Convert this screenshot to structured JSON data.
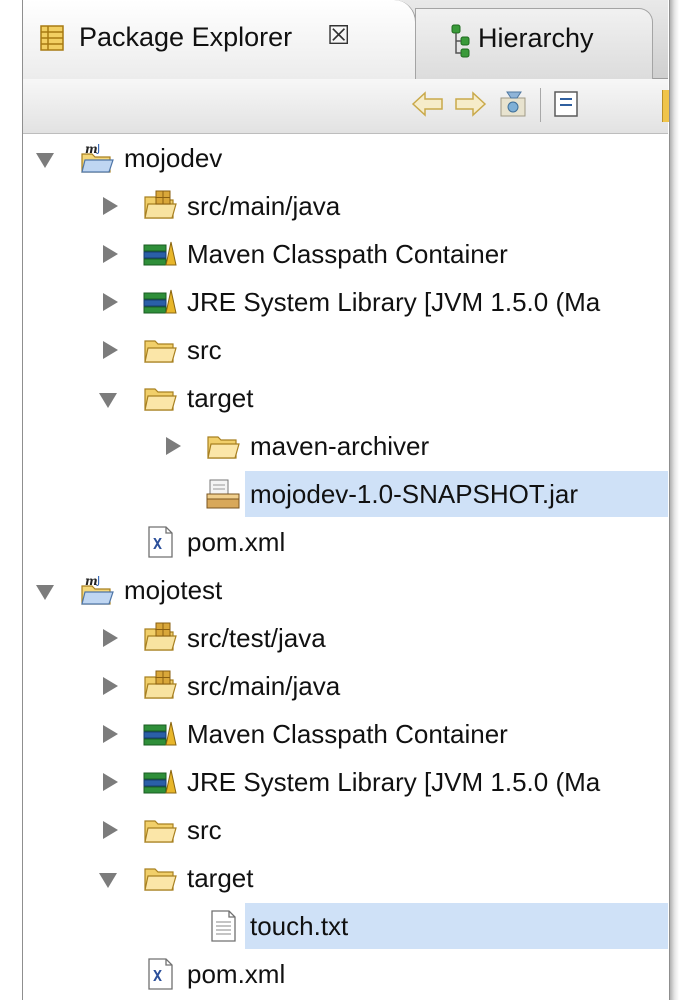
{
  "tabs": {
    "active": {
      "label": "Package Explorer",
      "close": "☒"
    },
    "inactive": {
      "label": "Hierarchy"
    }
  },
  "toolbar": {
    "buttons": [
      "back-icon",
      "forward-icon",
      "go-into-icon",
      "collapse-all-icon"
    ]
  },
  "tree": [
    {
      "label": "mojodev",
      "icon": "maven-project-icon",
      "depth": 0,
      "expander": "open"
    },
    {
      "label": "src/main/java",
      "icon": "source-folder-icon",
      "depth": 1,
      "expander": "closed"
    },
    {
      "label": "Maven Classpath Container",
      "icon": "library-icon",
      "depth": 1,
      "expander": "closed"
    },
    {
      "label": "JRE System Library [JVM 1.5.0 (Ma",
      "icon": "library-icon",
      "depth": 1,
      "expander": "closed"
    },
    {
      "label": "src",
      "icon": "folder-icon",
      "depth": 1,
      "expander": "closed"
    },
    {
      "label": "target",
      "icon": "folder-icon",
      "depth": 1,
      "expander": "open"
    },
    {
      "label": "maven-archiver",
      "icon": "folder-icon",
      "depth": 2,
      "expander": "closed"
    },
    {
      "label": "mojodev-1.0-SNAPSHOT.jar",
      "icon": "jar-icon",
      "depth": 2,
      "expander": "none",
      "selected": true
    },
    {
      "label": "pom.xml",
      "icon": "xml-file-icon",
      "depth": 1,
      "expander": "none"
    },
    {
      "label": "mojotest",
      "icon": "maven-project-icon",
      "depth": 0,
      "expander": "open"
    },
    {
      "label": "src/test/java",
      "icon": "source-folder-icon",
      "depth": 1,
      "expander": "closed"
    },
    {
      "label": "src/main/java",
      "icon": "source-folder-icon",
      "depth": 1,
      "expander": "closed"
    },
    {
      "label": "Maven Classpath Container",
      "icon": "library-icon",
      "depth": 1,
      "expander": "closed"
    },
    {
      "label": "JRE System Library [JVM 1.5.0 (Ma",
      "icon": "library-icon",
      "depth": 1,
      "expander": "closed"
    },
    {
      "label": "src",
      "icon": "folder-icon",
      "depth": 1,
      "expander": "closed"
    },
    {
      "label": "target",
      "icon": "folder-icon",
      "depth": 1,
      "expander": "open"
    },
    {
      "label": "touch.txt",
      "icon": "text-file-icon",
      "depth": 2,
      "expander": "none",
      "selected": true
    },
    {
      "label": "pom.xml",
      "icon": "xml-file-icon",
      "depth": 1,
      "expander": "none"
    }
  ],
  "colors": {
    "selection": "#cfe1f7",
    "folder": "#f3cf62",
    "library_green": "#2f8f3a",
    "library_blue": "#2a5fa8"
  }
}
